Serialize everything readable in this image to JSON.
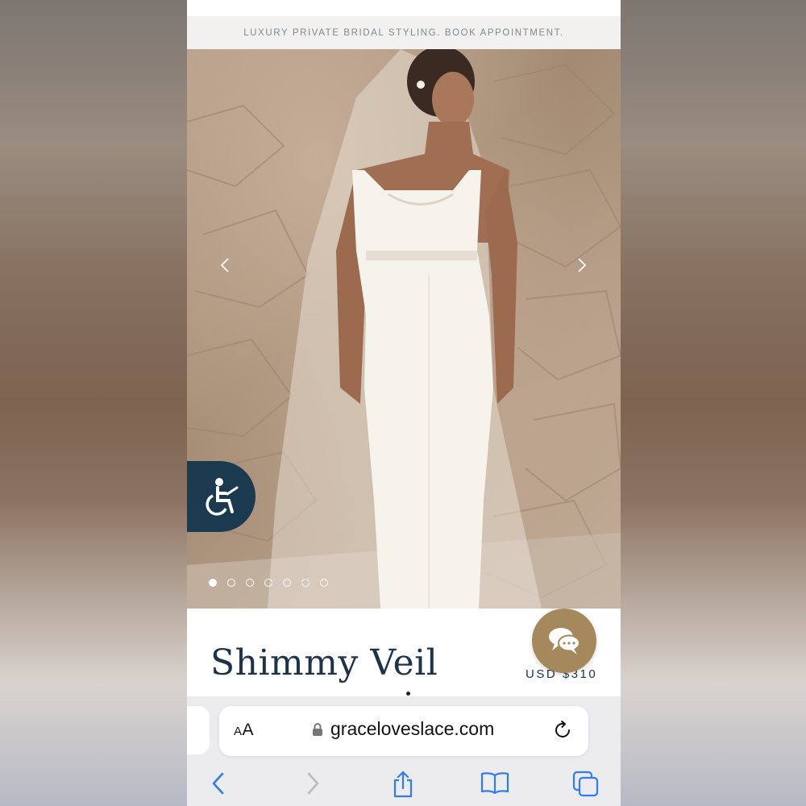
{
  "promo": {
    "text": "LUXURY PRIVATE BRIDAL STYLING. BOOK APPOINTMENT."
  },
  "gallery": {
    "slide_count": 7,
    "active_slide": 1,
    "prev_icon": "chevron-left-icon",
    "next_icon": "chevron-right-icon"
  },
  "accessibility": {
    "icon": "wheelchair-icon"
  },
  "product": {
    "title": "Shimmy Veil",
    "price": "USD $310"
  },
  "chat": {
    "icon": "chat-bubbles-icon"
  },
  "browser": {
    "text_size_label_small": "A",
    "text_size_label_large": "A",
    "url": "graceloveslace.com",
    "lock_icon": "lock-icon",
    "reload_icon": "reload-icon",
    "toolbar": [
      "back-icon",
      "forward-icon",
      "share-icon",
      "bookmarks-icon",
      "tabs-icon"
    ]
  },
  "colors": {
    "brand_navy": "#1c3a4f",
    "chat_gold": "#a5885c",
    "ios_blue": "#2f7cf6",
    "promo_text": "#7d8a94"
  }
}
